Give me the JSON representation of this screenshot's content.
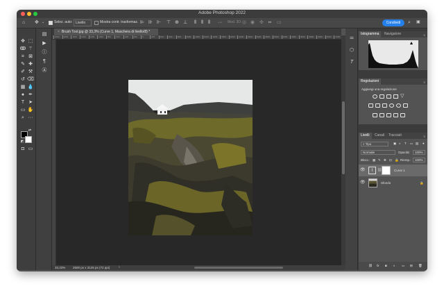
{
  "app": {
    "title": "Adobe Photoshop 2022",
    "traffic_lights": {
      "close": "#ff5f57",
      "minimize": "#febc2e",
      "zoom": "#28c840"
    }
  },
  "options_bar": {
    "home_icon": "home-icon",
    "move_icon": "move-icon",
    "auto_select_label": "Selez. auto:",
    "auto_select_value": "Livello",
    "show_transform_label": "Mostra contr. trasformaz.",
    "mode_3d_label": "Mod. 3D:",
    "share_label": "Condividi"
  },
  "document": {
    "tab_label": "Brush Tool.jpg @ 33,3% (Curve 1, Maschera di livello/8) *",
    "zoom": "33,33%",
    "size": "2500 px x 3125 px (72 ppi)"
  },
  "ruler": {
    "ticks": [
      "2000",
      "1800",
      "1600",
      "1400",
      "1200",
      "1000",
      "800",
      "600",
      "400",
      "200",
      "0",
      "200",
      "400",
      "600",
      "800",
      "1000",
      "1200",
      "1400",
      "1600",
      "1800",
      "2000",
      "2200",
      "2400",
      "2600",
      "2800",
      "3000",
      "3200",
      "3400",
      "3600",
      "3800",
      "4000",
      "4200",
      "4400"
    ]
  },
  "panels": {
    "histogram": {
      "tabs": [
        "Istogramma",
        "Navigatore"
      ]
    },
    "adjustments": {
      "title": "Regolazioni",
      "subtitle": "Aggiungi una regolazione"
    },
    "layers": {
      "tabs": [
        "Livelli",
        "Canali",
        "Tracciati"
      ],
      "filter_value": "Tipo",
      "blend_mode": "Normale",
      "opacity_label": "Opacità:",
      "opacity_value": "100%",
      "lock_label": "Blocc.:",
      "fill_label": "Riemp.:",
      "fill_value": "100%",
      "items": [
        {
          "name": "Curve 1",
          "selected": true
        },
        {
          "name": "Sfondo",
          "selected": false,
          "locked": true
        }
      ]
    }
  },
  "colors": {
    "accent": "#2680eb",
    "app_bg": "#535353",
    "canvas_bg": "#282828"
  }
}
